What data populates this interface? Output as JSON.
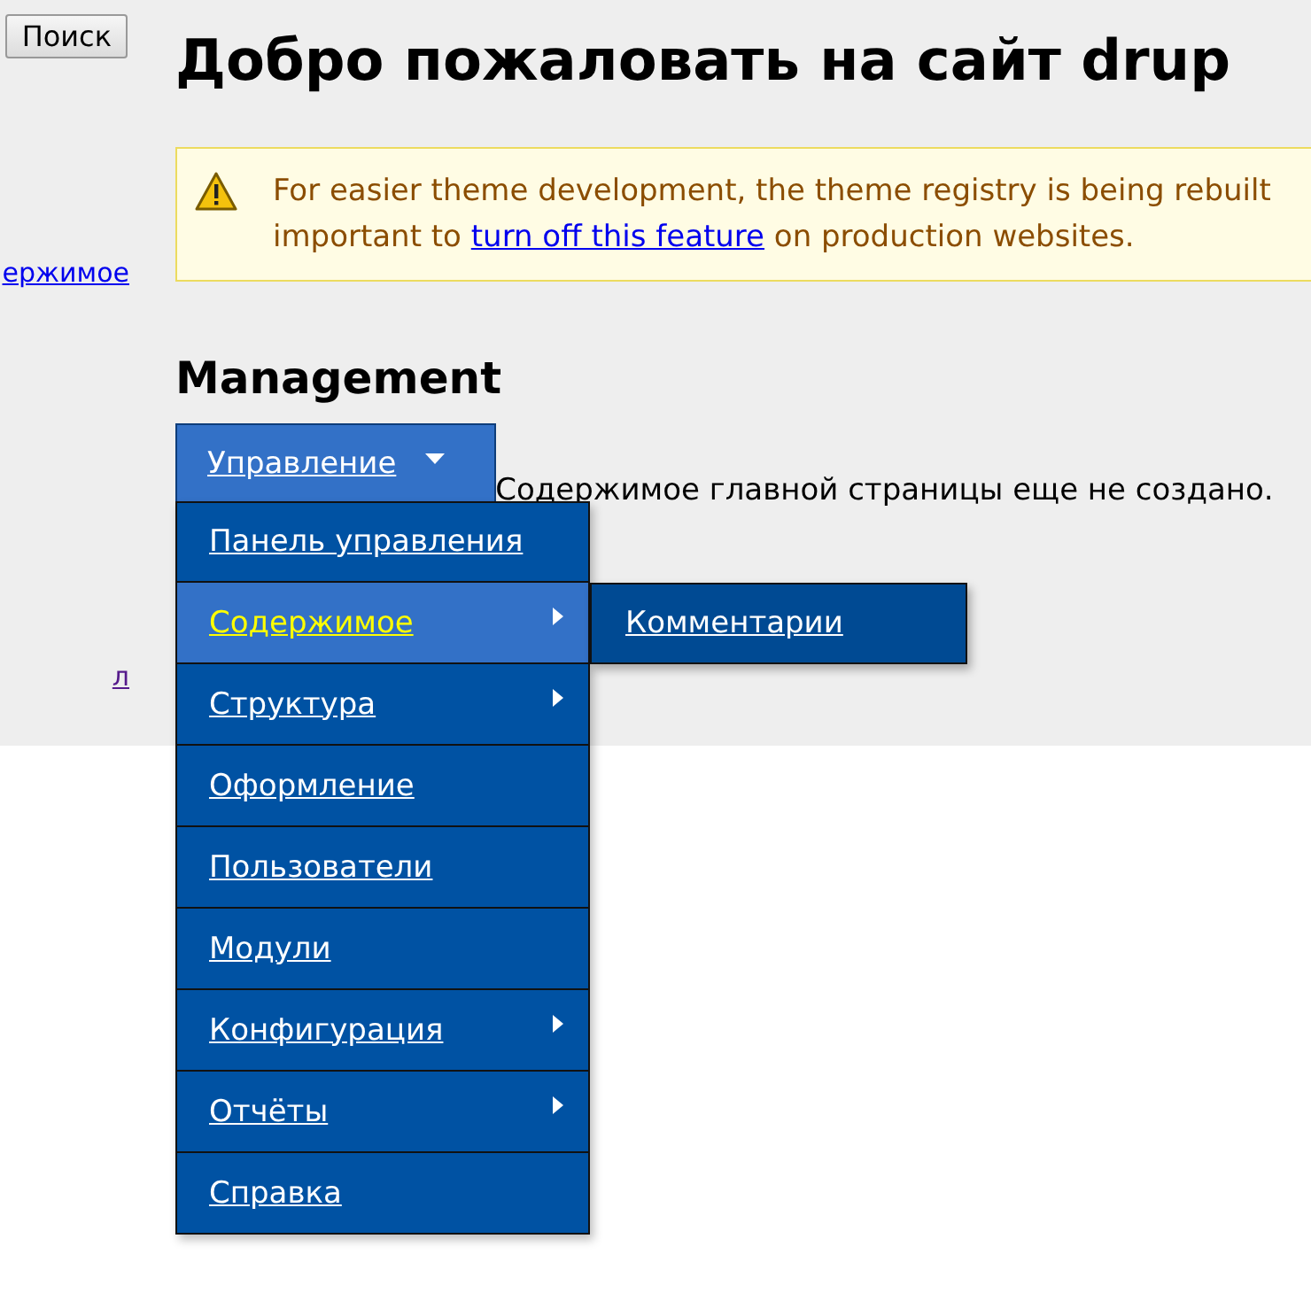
{
  "sidebar": {
    "search_button": "Поиск",
    "links": [
      {
        "label": "ержимое",
        "visited": false
      },
      {
        "label": "л",
        "visited": true
      }
    ]
  },
  "page_title": "Добро пожаловать на сайт drup",
  "message": {
    "kind": "warning",
    "line_1": "For easier theme development, the theme registry is being rebuilt",
    "line_2_before": "important to",
    "link": "turn off this feature",
    "line_2_after": "on production websites."
  },
  "block_title": "Management",
  "menu": {
    "label": "Управление",
    "expanded": true,
    "items": [
      {
        "label": "Панель управления",
        "has_children": false,
        "selected": false
      },
      {
        "label": "Содержимое",
        "has_children": true,
        "selected": true,
        "children": [
          {
            "label": "Комментарии"
          }
        ]
      },
      {
        "label": "Структура",
        "has_children": true,
        "selected": false
      },
      {
        "label": "Оформление",
        "has_children": false,
        "selected": false
      },
      {
        "label": "Пользователи",
        "has_children": false,
        "selected": false
      },
      {
        "label": "Модули",
        "has_children": false,
        "selected": false
      },
      {
        "label": "Конфигурация",
        "has_children": true,
        "selected": false
      },
      {
        "label": "Отчёты",
        "has_children": true,
        "selected": false
      },
      {
        "label": "Справка",
        "has_children": false,
        "selected": false
      }
    ]
  },
  "content_text": "Содержимое главной страницы еще не создано."
}
